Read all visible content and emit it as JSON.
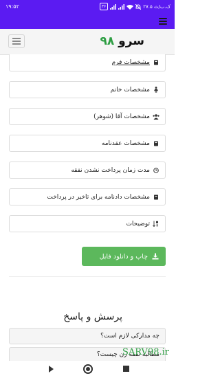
{
  "statusbar": {
    "time": "۱۹:۵۲",
    "speed": "۲۷.۵ ک.ب/ث",
    "battery": "۳۶"
  },
  "navbar": {
    "brand_text": "سرو",
    "brand_number": "۹۸"
  },
  "menu": [
    {
      "label": "مشخصات فرم",
      "icon": "book-icon",
      "underline": true
    },
    {
      "label": "مشخصات خانم",
      "icon": "female-icon"
    },
    {
      "label": "مشخصات آقا (شوهر)",
      "icon": "users-icon"
    },
    {
      "label": "مشخصات عقدنامه",
      "icon": "book-icon"
    },
    {
      "label": "مدت زمان پرداخت نشدن نفقه",
      "icon": "clock-icon"
    },
    {
      "label": "مشخصات دادنامه برای تاخیر در پرداخت",
      "icon": "book-icon"
    },
    {
      "label": "توضیحات",
      "icon": "sort-icon"
    }
  ],
  "download_button": {
    "label": "چاپ و دانلود فایل",
    "icon": "download-icon",
    "color": "#5cb85c"
  },
  "faq": {
    "title": "پرسش و پاسخ",
    "items": [
      "چه مدارکی لازم است؟",
      "مطالبه نفقه زن چیست؟"
    ]
  },
  "watermark": "SARV98.ir",
  "colors": {
    "accent": "#5b1bf2",
    "brand_green": "#2e9e43"
  }
}
